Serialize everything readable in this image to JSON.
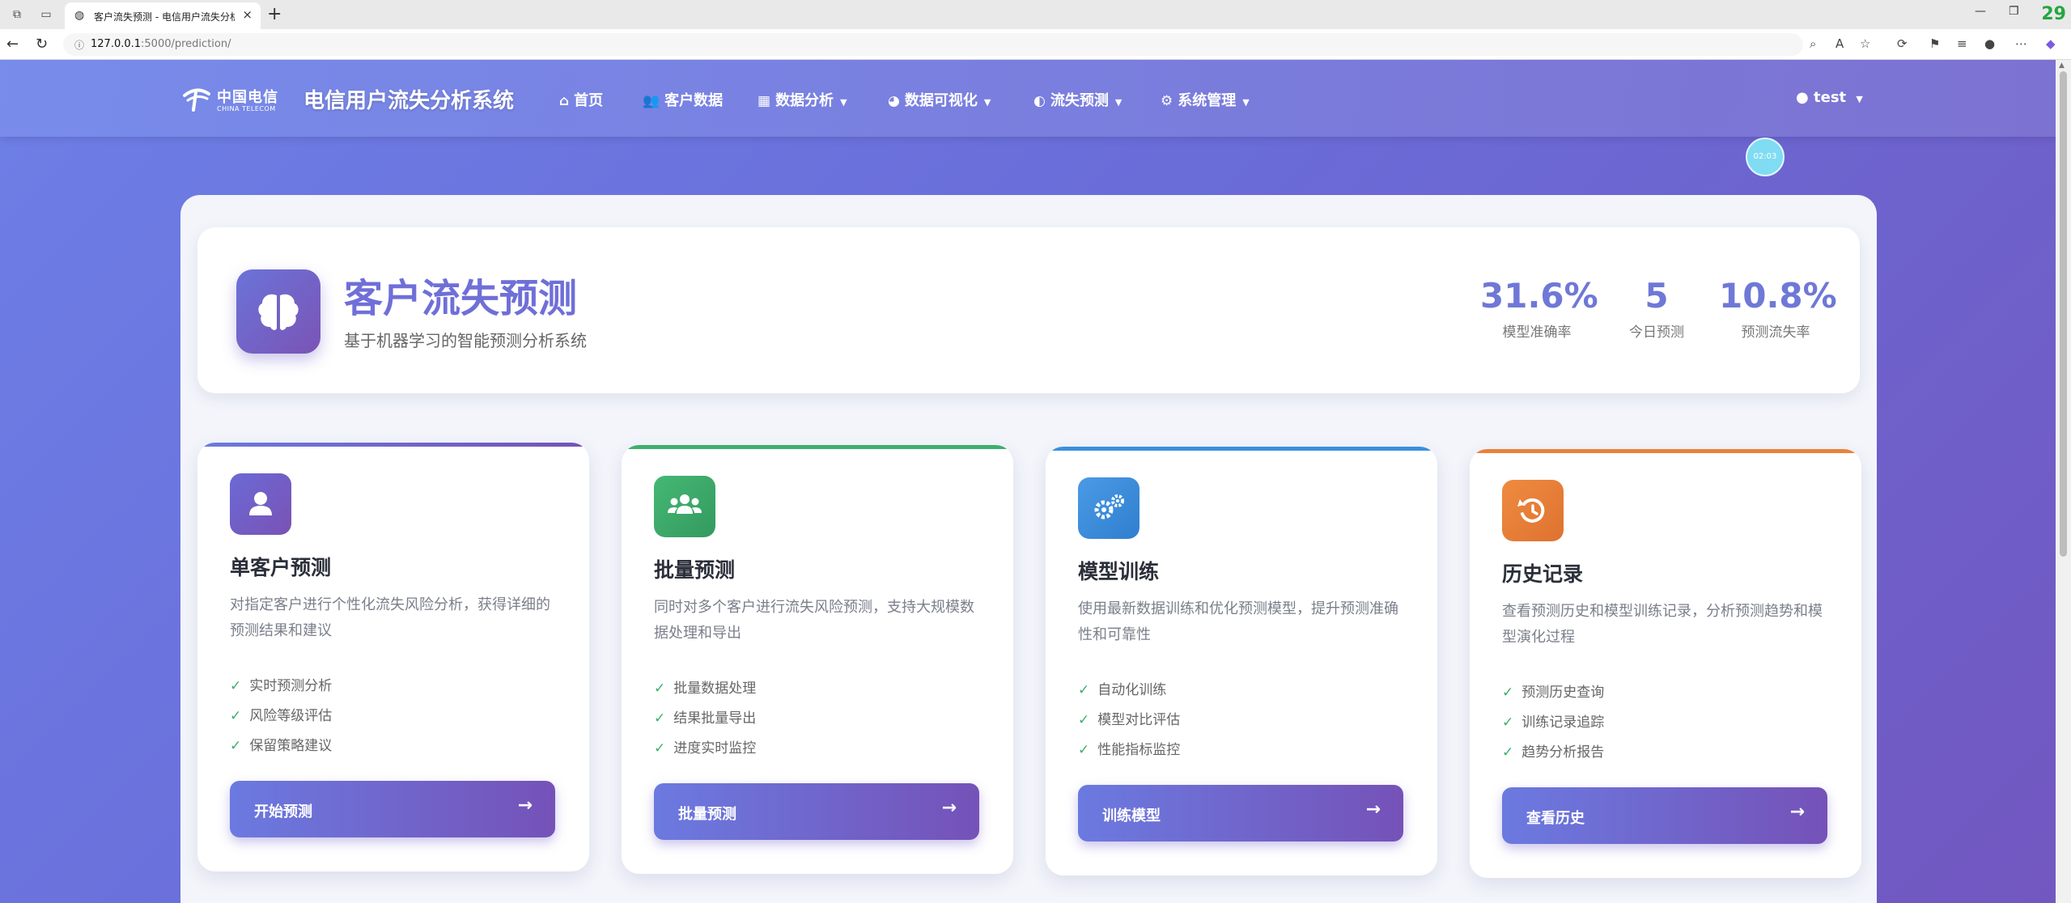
{
  "browser": {
    "tab_title": "客户流失预测 - 电信用户流失分析",
    "url_host": "127.0.0.1",
    "url_path": ":5000/prediction/",
    "corner_badge": "29"
  },
  "navbar": {
    "logo_cn": "中国电信",
    "logo_en": "CHINA TELECOM",
    "brand": "电信用户流失分析系统",
    "items": [
      {
        "label": "首页",
        "icon": "home-icon"
      },
      {
        "label": "客户数据",
        "icon": "users-icon"
      },
      {
        "label": "数据分析",
        "icon": "chart-icon"
      },
      {
        "label": "数据可视化",
        "icon": "pie-icon"
      },
      {
        "label": "流失预测",
        "icon": "brain-icon"
      },
      {
        "label": "系统管理",
        "icon": "gear-icon"
      }
    ],
    "user": "test",
    "timer": "02:03"
  },
  "hero": {
    "title": "客户流失预测",
    "subtitle": "基于机器学习的智能预测分析系统",
    "stats": [
      {
        "value": "31.6%",
        "label": "模型准确率"
      },
      {
        "value": "5",
        "label": "今日预测"
      },
      {
        "value": "10.8%",
        "label": "预测流失率"
      }
    ]
  },
  "cards": [
    {
      "title": "单客户预测",
      "desc": "对指定客户进行个性化流失风险分析，获得详细的预测结果和建议",
      "features": [
        "实时预测分析",
        "风险等级评估",
        "保留策略建议"
      ],
      "button": "开始预测",
      "accent": "#7654b8",
      "icon": "user-icon"
    },
    {
      "title": "批量预测",
      "desc": "同时对多个客户进行流失风险预测，支持大规模数据处理和导出",
      "features": [
        "批量数据处理",
        "结果批量导出",
        "进度实时监控"
      ],
      "button": "批量预测",
      "accent": "#3fae6d",
      "icon": "users-icon"
    },
    {
      "title": "模型训练",
      "desc": "使用最新数据训练和优化预测模型，提升预测准确性和可靠性",
      "features": [
        "自动化训练",
        "模型对比评估",
        "性能指标监控"
      ],
      "button": "训练模型",
      "accent": "#3b8fde",
      "icon": "cogs-icon"
    },
    {
      "title": "历史记录",
      "desc": "查看预测历史和模型训练记录，分析预测趋势和模型演化过程",
      "features": [
        "预测历史查询",
        "训练记录追踪",
        "趋势分析报告"
      ],
      "button": "查看历史",
      "accent": "#e9823a",
      "icon": "history-icon"
    }
  ]
}
